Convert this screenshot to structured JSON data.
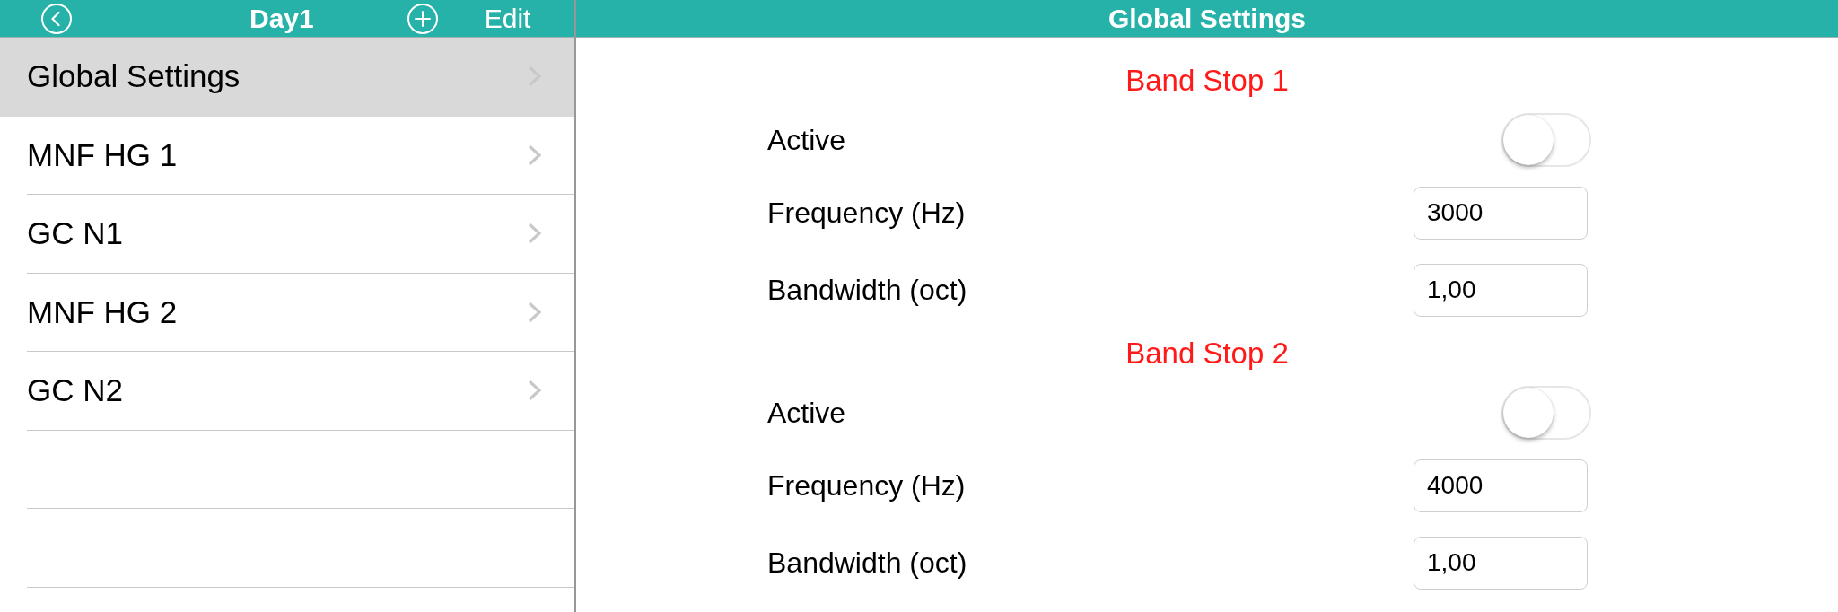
{
  "sidebar": {
    "title": "Day1",
    "edit_button": "Edit",
    "items": [
      {
        "label": "Global Settings",
        "selected": true
      },
      {
        "label": "MNF HG 1",
        "selected": false
      },
      {
        "label": "GC N1",
        "selected": false
      },
      {
        "label": "MNF HG 2",
        "selected": false
      },
      {
        "label": "GC N2",
        "selected": false
      }
    ]
  },
  "detail": {
    "title": "Global Settings",
    "sections": [
      {
        "title": "Band Stop 1",
        "rows": [
          {
            "kind": "toggle",
            "label": "Active",
            "on": false
          },
          {
            "kind": "field",
            "label": "Frequency (Hz)",
            "value": "3000"
          },
          {
            "kind": "field",
            "label": "Bandwidth (oct)",
            "value": "1,00"
          }
        ]
      },
      {
        "title": "Band Stop 2",
        "rows": [
          {
            "kind": "toggle",
            "label": "Active",
            "on": false
          },
          {
            "kind": "field",
            "label": "Frequency (Hz)",
            "value": "4000"
          },
          {
            "kind": "field",
            "label": "Bandwidth (oct)",
            "value": "1,00"
          }
        ]
      }
    ]
  }
}
